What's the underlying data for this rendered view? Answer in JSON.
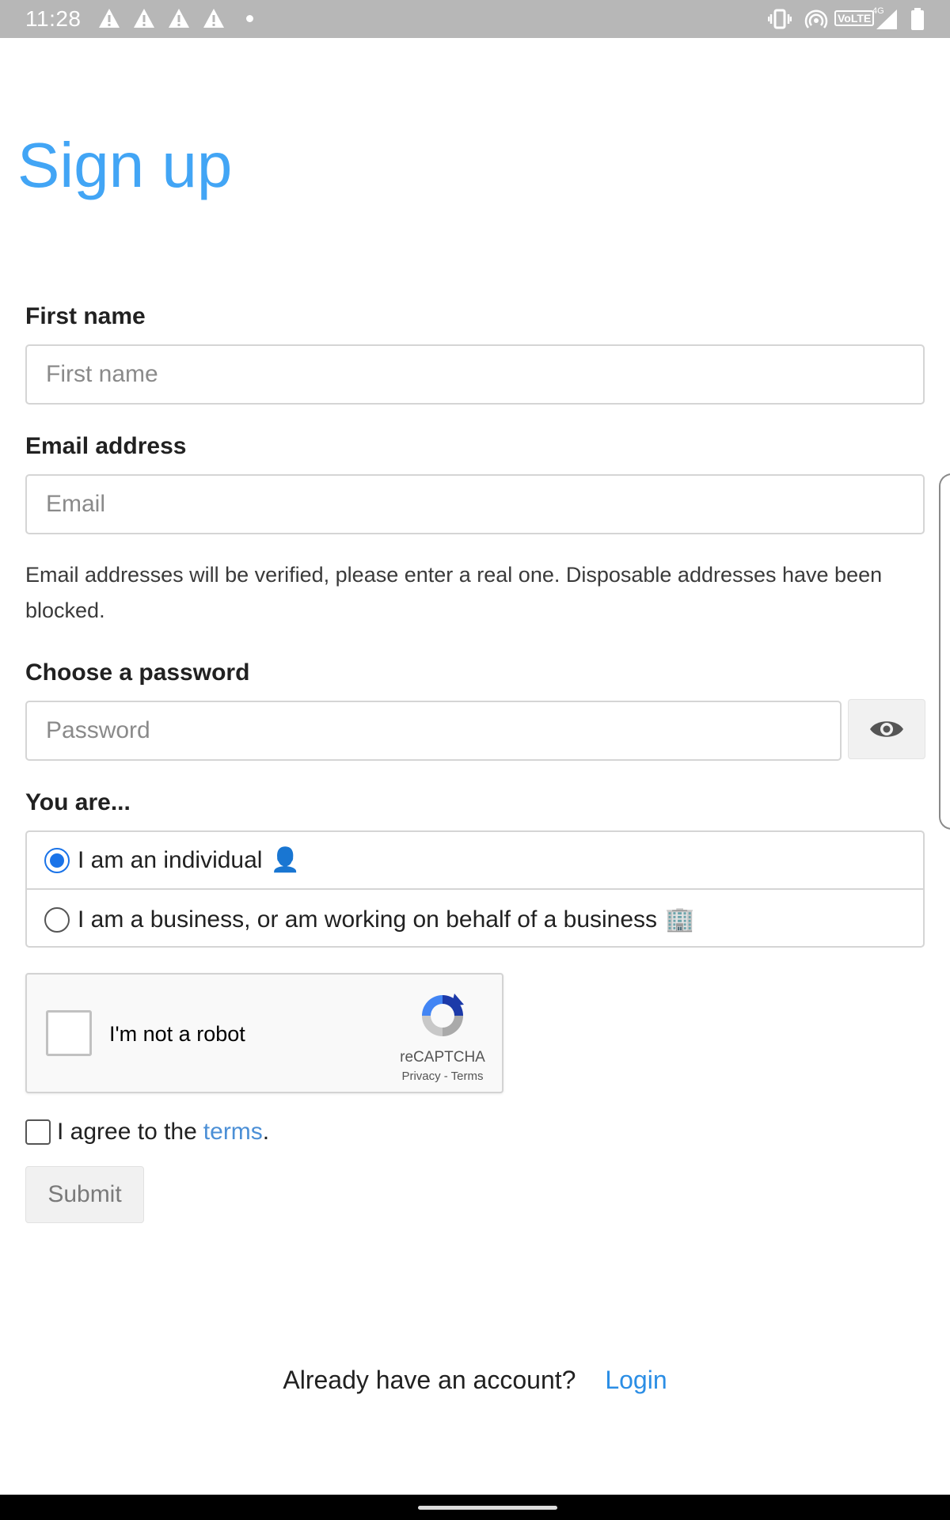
{
  "status_bar": {
    "time": "11:28",
    "icons": [
      "warning-icon",
      "warning-icon",
      "warning-icon",
      "warning-icon",
      "dot-icon",
      "vibrate-icon",
      "hotspot-icon",
      "volte-icon",
      "signal-icon",
      "battery-icon"
    ],
    "volte_label": "VoLTE",
    "network_label": "4G"
  },
  "page": {
    "title": "Sign up"
  },
  "form": {
    "first_name": {
      "label": "First name",
      "placeholder": "First name",
      "value": ""
    },
    "email": {
      "label": "Email address",
      "placeholder": "Email",
      "value": "",
      "help": "Email addresses will be verified, please enter a real one. Disposable addresses have been blocked."
    },
    "password": {
      "label": "Choose a password",
      "placeholder": "Password",
      "value": "",
      "toggle_icon": "eye-icon"
    },
    "account_type": {
      "label": "You are...",
      "options": [
        {
          "label": "I am an individual",
          "emoji": "👤",
          "checked": true
        },
        {
          "label": "I am a business, or am working on behalf of a business",
          "emoji": "🏢",
          "checked": false
        }
      ]
    },
    "recaptcha": {
      "label": "I'm not a robot",
      "brand": "reCAPTCHA",
      "links": "Privacy - Terms"
    },
    "terms": {
      "prefix": "I agree to the",
      "link": "terms",
      "suffix": ".",
      "checked": false
    },
    "submit_label": "Submit"
  },
  "footer": {
    "prompt": "Already have an account?",
    "login_label": "Login"
  },
  "colors": {
    "title": "#42a5f5",
    "link": "#2b8ee5",
    "radio_accent": "#1a73e8",
    "status_bar": "#b7b7b7"
  }
}
